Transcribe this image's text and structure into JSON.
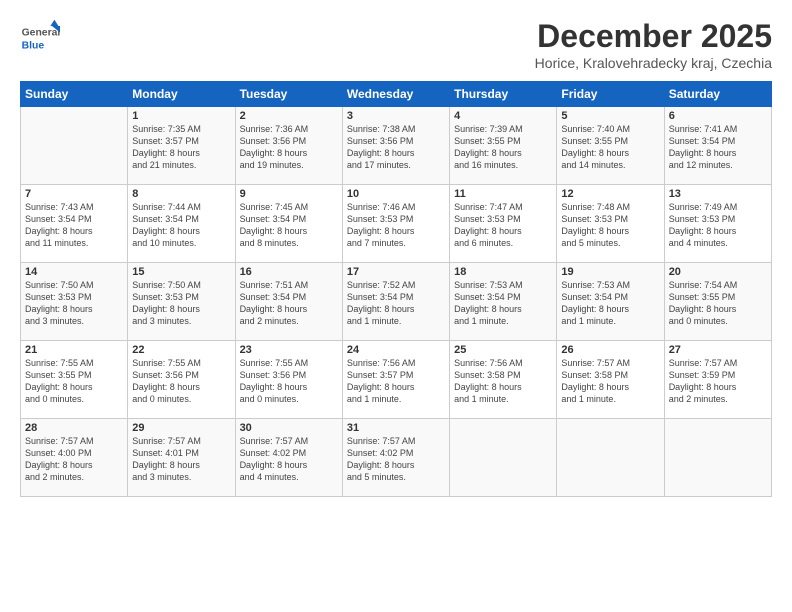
{
  "logo": {
    "general": "General",
    "blue": "Blue"
  },
  "title": "December 2025",
  "subtitle": "Horice, Kralovehradecky kraj, Czechia",
  "headers": [
    "Sunday",
    "Monday",
    "Tuesday",
    "Wednesday",
    "Thursday",
    "Friday",
    "Saturday"
  ],
  "weeks": [
    [
      {
        "day": "",
        "info": ""
      },
      {
        "day": "1",
        "info": "Sunrise: 7:35 AM\nSunset: 3:57 PM\nDaylight: 8 hours\nand 21 minutes."
      },
      {
        "day": "2",
        "info": "Sunrise: 7:36 AM\nSunset: 3:56 PM\nDaylight: 8 hours\nand 19 minutes."
      },
      {
        "day": "3",
        "info": "Sunrise: 7:38 AM\nSunset: 3:56 PM\nDaylight: 8 hours\nand 17 minutes."
      },
      {
        "day": "4",
        "info": "Sunrise: 7:39 AM\nSunset: 3:55 PM\nDaylight: 8 hours\nand 16 minutes."
      },
      {
        "day": "5",
        "info": "Sunrise: 7:40 AM\nSunset: 3:55 PM\nDaylight: 8 hours\nand 14 minutes."
      },
      {
        "day": "6",
        "info": "Sunrise: 7:41 AM\nSunset: 3:54 PM\nDaylight: 8 hours\nand 12 minutes."
      }
    ],
    [
      {
        "day": "7",
        "info": "Sunrise: 7:43 AM\nSunset: 3:54 PM\nDaylight: 8 hours\nand 11 minutes."
      },
      {
        "day": "8",
        "info": "Sunrise: 7:44 AM\nSunset: 3:54 PM\nDaylight: 8 hours\nand 10 minutes."
      },
      {
        "day": "9",
        "info": "Sunrise: 7:45 AM\nSunset: 3:54 PM\nDaylight: 8 hours\nand 8 minutes."
      },
      {
        "day": "10",
        "info": "Sunrise: 7:46 AM\nSunset: 3:53 PM\nDaylight: 8 hours\nand 7 minutes."
      },
      {
        "day": "11",
        "info": "Sunrise: 7:47 AM\nSunset: 3:53 PM\nDaylight: 8 hours\nand 6 minutes."
      },
      {
        "day": "12",
        "info": "Sunrise: 7:48 AM\nSunset: 3:53 PM\nDaylight: 8 hours\nand 5 minutes."
      },
      {
        "day": "13",
        "info": "Sunrise: 7:49 AM\nSunset: 3:53 PM\nDaylight: 8 hours\nand 4 minutes."
      }
    ],
    [
      {
        "day": "14",
        "info": "Sunrise: 7:50 AM\nSunset: 3:53 PM\nDaylight: 8 hours\nand 3 minutes."
      },
      {
        "day": "15",
        "info": "Sunrise: 7:50 AM\nSunset: 3:53 PM\nDaylight: 8 hours\nand 3 minutes."
      },
      {
        "day": "16",
        "info": "Sunrise: 7:51 AM\nSunset: 3:54 PM\nDaylight: 8 hours\nand 2 minutes."
      },
      {
        "day": "17",
        "info": "Sunrise: 7:52 AM\nSunset: 3:54 PM\nDaylight: 8 hours\nand 1 minute."
      },
      {
        "day": "18",
        "info": "Sunrise: 7:53 AM\nSunset: 3:54 PM\nDaylight: 8 hours\nand 1 minute."
      },
      {
        "day": "19",
        "info": "Sunrise: 7:53 AM\nSunset: 3:54 PM\nDaylight: 8 hours\nand 1 minute."
      },
      {
        "day": "20",
        "info": "Sunrise: 7:54 AM\nSunset: 3:55 PM\nDaylight: 8 hours\nand 0 minutes."
      }
    ],
    [
      {
        "day": "21",
        "info": "Sunrise: 7:55 AM\nSunset: 3:55 PM\nDaylight: 8 hours\nand 0 minutes."
      },
      {
        "day": "22",
        "info": "Sunrise: 7:55 AM\nSunset: 3:56 PM\nDaylight: 8 hours\nand 0 minutes."
      },
      {
        "day": "23",
        "info": "Sunrise: 7:55 AM\nSunset: 3:56 PM\nDaylight: 8 hours\nand 0 minutes."
      },
      {
        "day": "24",
        "info": "Sunrise: 7:56 AM\nSunset: 3:57 PM\nDaylight: 8 hours\nand 1 minute."
      },
      {
        "day": "25",
        "info": "Sunrise: 7:56 AM\nSunset: 3:58 PM\nDaylight: 8 hours\nand 1 minute."
      },
      {
        "day": "26",
        "info": "Sunrise: 7:57 AM\nSunset: 3:58 PM\nDaylight: 8 hours\nand 1 minute."
      },
      {
        "day": "27",
        "info": "Sunrise: 7:57 AM\nSunset: 3:59 PM\nDaylight: 8 hours\nand 2 minutes."
      }
    ],
    [
      {
        "day": "28",
        "info": "Sunrise: 7:57 AM\nSunset: 4:00 PM\nDaylight: 8 hours\nand 2 minutes."
      },
      {
        "day": "29",
        "info": "Sunrise: 7:57 AM\nSunset: 4:01 PM\nDaylight: 8 hours\nand 3 minutes."
      },
      {
        "day": "30",
        "info": "Sunrise: 7:57 AM\nSunset: 4:02 PM\nDaylight: 8 hours\nand 4 minutes."
      },
      {
        "day": "31",
        "info": "Sunrise: 7:57 AM\nSunset: 4:02 PM\nDaylight: 8 hours\nand 5 minutes."
      },
      {
        "day": "",
        "info": ""
      },
      {
        "day": "",
        "info": ""
      },
      {
        "day": "",
        "info": ""
      }
    ]
  ]
}
